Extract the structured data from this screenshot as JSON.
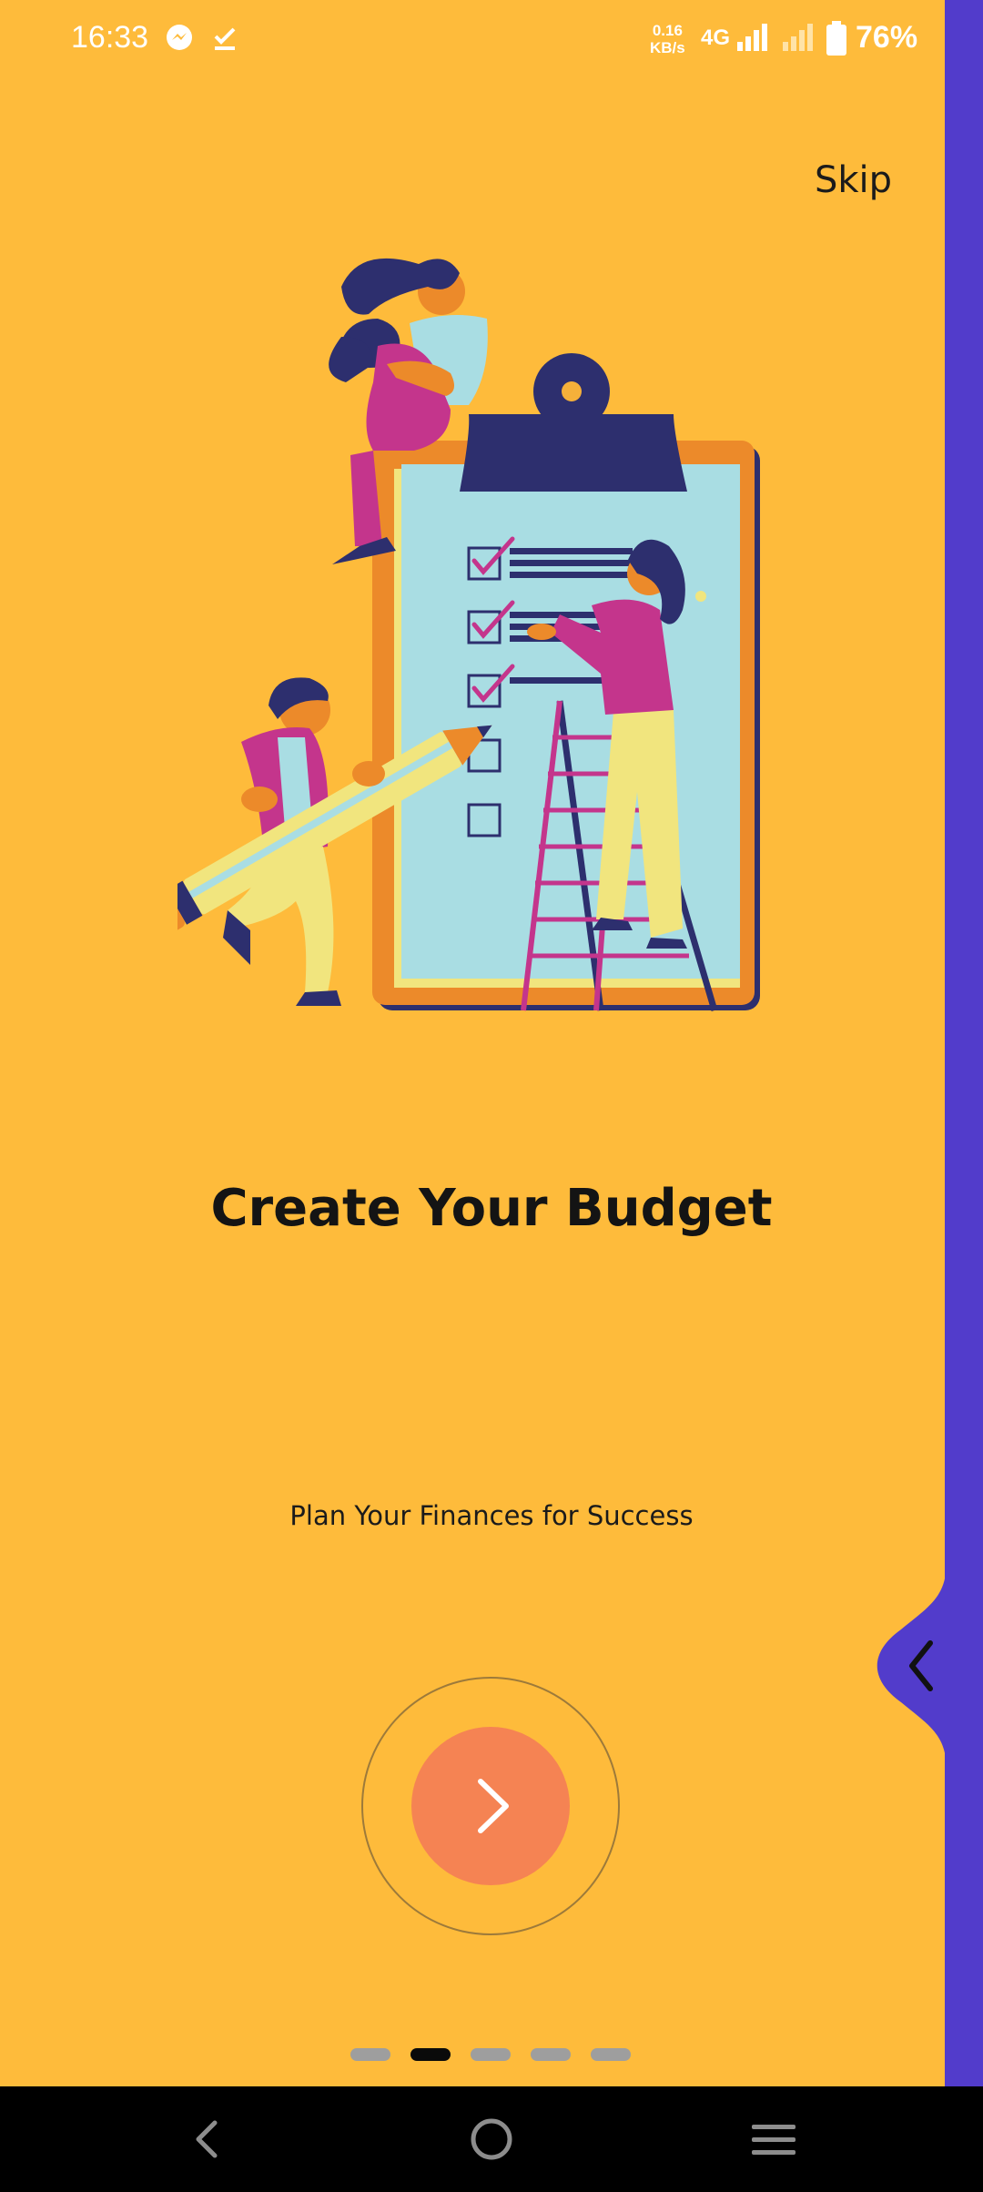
{
  "status_bar": {
    "time": "16:33",
    "net_speed_value": "0.16",
    "net_speed_unit": "KB/s",
    "network_type": "4G",
    "battery_percent": "76%",
    "icons": [
      "messenger-icon",
      "download-done-icon",
      "signal-icon",
      "signal-weak-icon",
      "battery-icon"
    ]
  },
  "onboarding": {
    "skip_label": "Skip",
    "title": "Create Your Budget",
    "subtitle": "Plan Your Finances for Success",
    "next_icon": "chevron-right-icon",
    "page_indicator": {
      "count": 5,
      "active_index": 1
    }
  },
  "side_panel": {
    "icon": "chevron-left-icon",
    "color": "#523CCB"
  },
  "colors": {
    "background": "#FEBB3B",
    "accent_button": "#F58353",
    "side_strip": "#523CCB",
    "dot_active": "#0a0a0a",
    "dot_inactive": "#9E9E9E"
  },
  "nav_bar": {
    "icons": [
      "back-icon",
      "home-icon",
      "menu-icon"
    ]
  }
}
